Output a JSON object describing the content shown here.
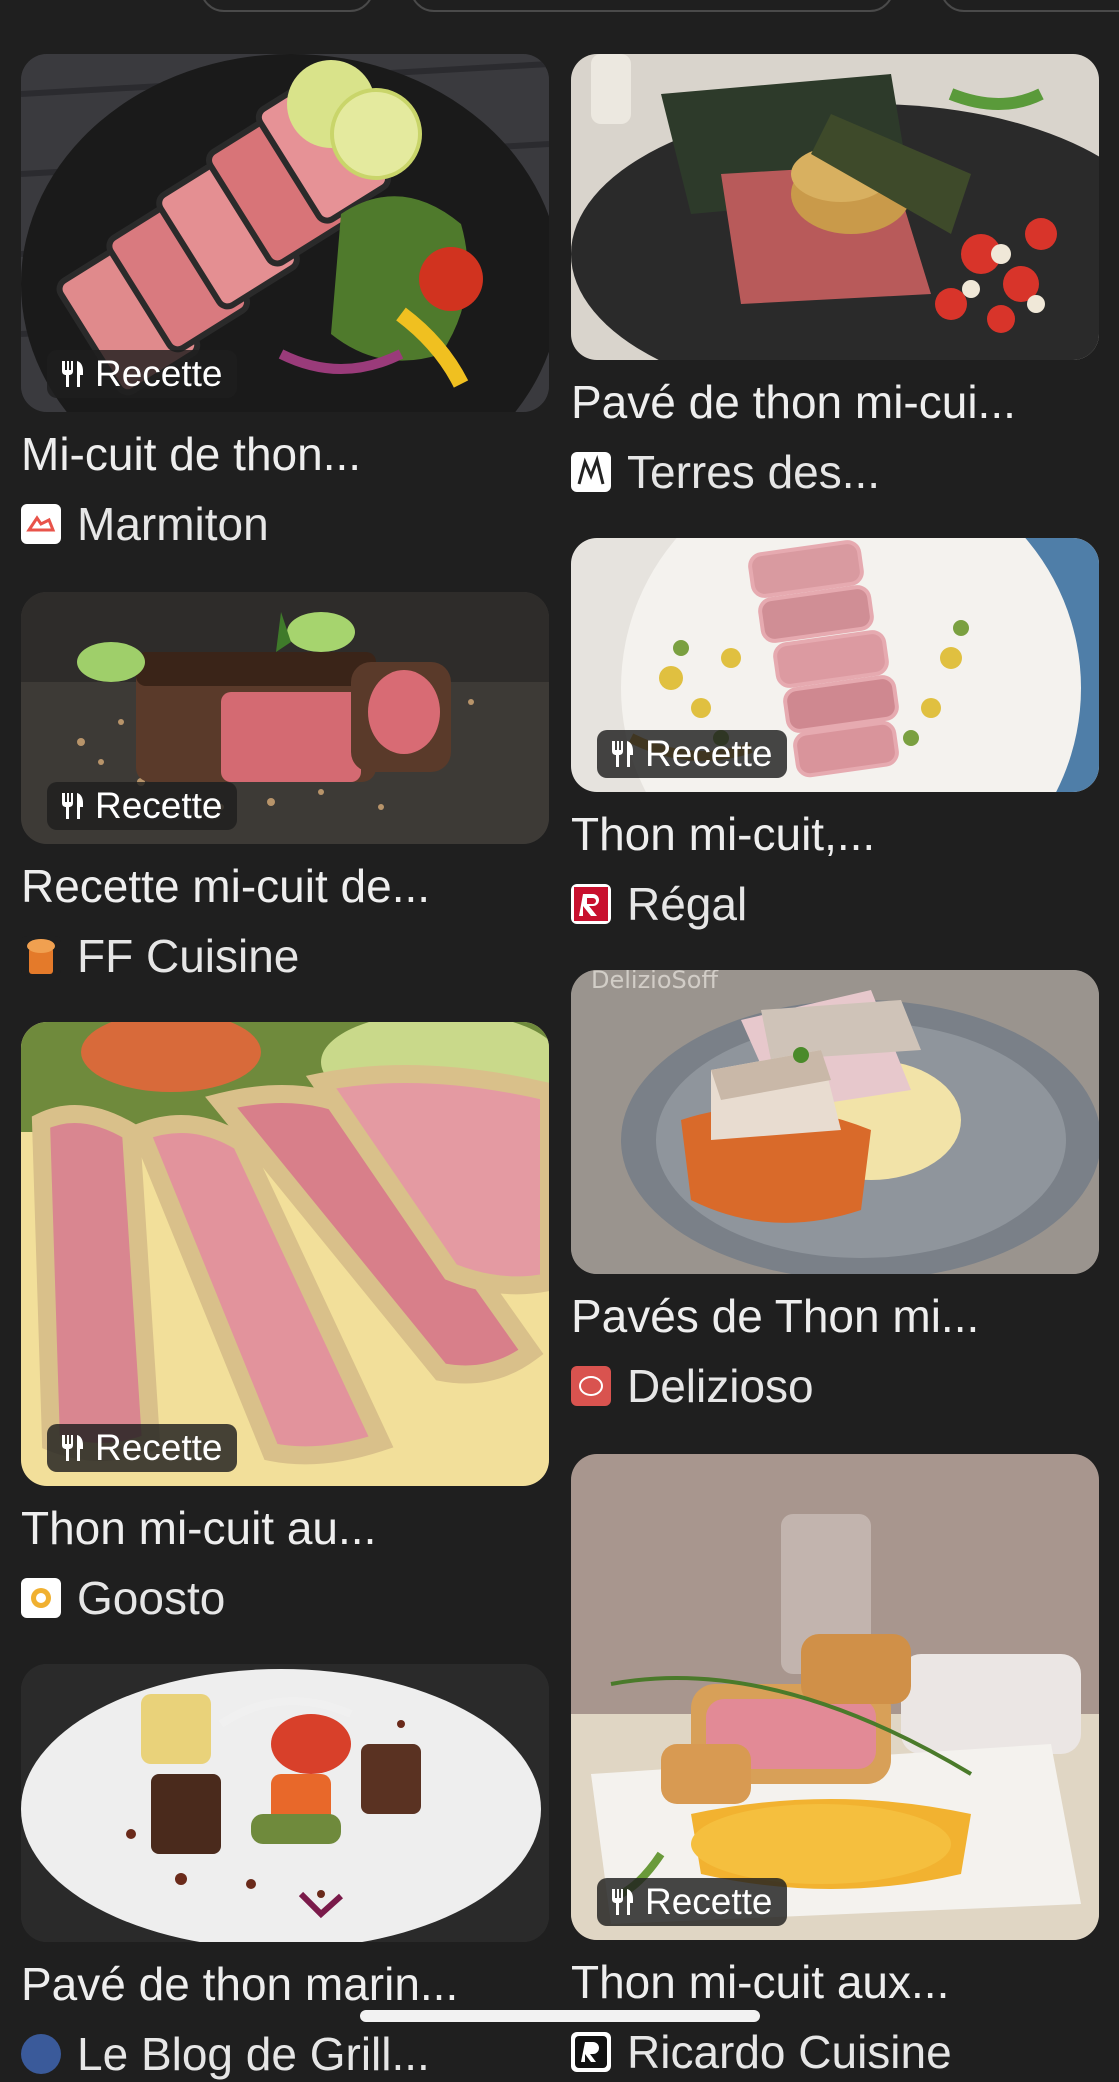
{
  "badge_label": "Recette",
  "colors": {
    "background": "#1f1f1f",
    "text": "#eeeeee",
    "badge_bg": "rgba(30,30,30,0.82)"
  },
  "results": [
    {
      "title": "Mi-cuit de thon...",
      "source": "Marmiton",
      "badge": true,
      "icon": "marmiton-logo-icon"
    },
    {
      "title": "Pavé de thon mi-cui...",
      "source": "Terres des...",
      "badge": false,
      "icon": "terres-des-logo-icon"
    },
    {
      "title": "Recette mi-cuit de...",
      "source": "FF Cuisine",
      "badge": true,
      "icon": "ff-cuisine-logo-icon"
    },
    {
      "title": "Thon mi-cuit,...",
      "source": "Régal",
      "badge": true,
      "icon": "regal-logo-icon"
    },
    {
      "title": "Thon mi-cuit au...",
      "source": "Goosto",
      "badge": true,
      "icon": "goosto-logo-icon"
    },
    {
      "title": "Pavés de Thon mi...",
      "source": "Delizioso",
      "badge": false,
      "icon": "delizioso-logo-icon"
    },
    {
      "title": "Pavé de thon marin...",
      "source": "Le Blog de Grill...",
      "badge": false,
      "icon": "grill-blog-logo-icon"
    },
    {
      "title": "Thon mi-cuit aux...",
      "source": "Ricardo Cuisine",
      "badge": true,
      "icon": "ricardo-logo-icon"
    }
  ],
  "watermark_delizioso": "DelizioSoff"
}
